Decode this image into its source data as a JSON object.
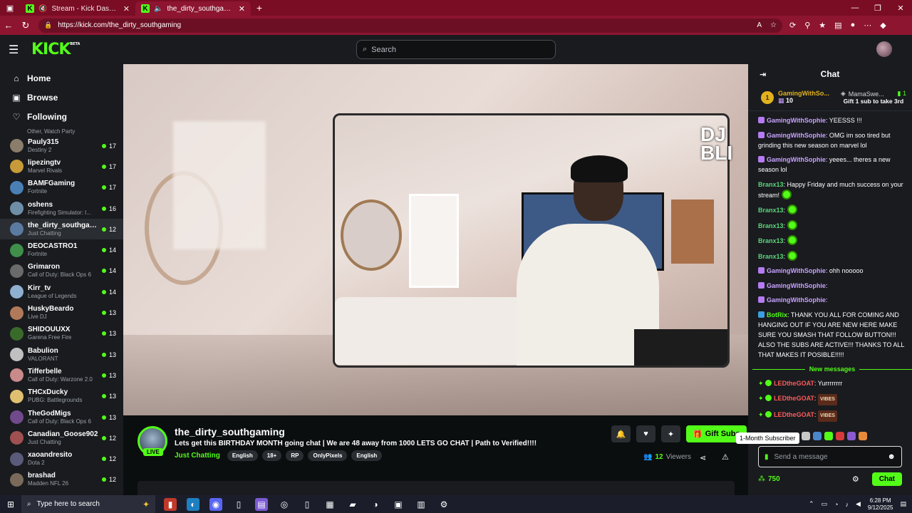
{
  "browser": {
    "tabs": [
      {
        "title": "Stream - Kick Dashboard",
        "active": false
      },
      {
        "title": "the_dirty_southgaming Stream",
        "active": true
      }
    ],
    "url": "https://kick.com/the_dirty_southgaming"
  },
  "header": {
    "logo": "KICK",
    "logo_tag": "BETA",
    "search_placeholder": "Search"
  },
  "sidebar": {
    "nav": [
      {
        "label": "Home",
        "icon": "home-icon"
      },
      {
        "label": "Browse",
        "icon": "browse-icon"
      },
      {
        "label": "Following",
        "icon": "heart-icon"
      }
    ],
    "cut_category": "Other, Watch Party",
    "channels": [
      {
        "name": "Pauly315",
        "category": "Destiny 2",
        "viewers": "17",
        "color": "#8a7d6a"
      },
      {
        "name": "lipezingtv",
        "category": "Marvel Rivals",
        "viewers": "17",
        "color": "#c79a3a"
      },
      {
        "name": "BAMFGaming",
        "category": "Fortnite",
        "viewers": "17",
        "color": "#4a7fb5"
      },
      {
        "name": "oshens",
        "category": "Firefighting Simulator: I...",
        "viewers": "16",
        "color": "#6f8fa8"
      },
      {
        "name": "the_dirty_southgami...",
        "category": "Just Chatting",
        "viewers": "12",
        "color": "#5a7aa0",
        "active": true
      },
      {
        "name": "DEOCASTRO1",
        "category": "Fortnite",
        "viewers": "14",
        "color": "#3f8f4a"
      },
      {
        "name": "Grimaron",
        "category": "Call of Duty: Black Ops 6",
        "viewers": "14",
        "color": "#6a6a6a"
      },
      {
        "name": "Kirr_tv",
        "category": "League of Legends",
        "viewers": "14",
        "color": "#8fb0d0"
      },
      {
        "name": "HuskyBeardo",
        "category": "Live DJ",
        "viewers": "13",
        "color": "#b07a5a"
      },
      {
        "name": "SHIDOUUXX",
        "category": "Garena Free Fire",
        "viewers": "13",
        "color": "#3a6a2a"
      },
      {
        "name": "Babulion",
        "category": "VALORANT",
        "viewers": "13",
        "color": "#c0c0c0"
      },
      {
        "name": "Tifferbelle",
        "category": "Call of Duty: Warzone 2.0",
        "viewers": "13",
        "color": "#c98a8a"
      },
      {
        "name": "THCxDucky",
        "category": "PUBG: Battlegrounds",
        "viewers": "13",
        "color": "#e0c070"
      },
      {
        "name": "TheGodMigs",
        "category": "Call of Duty: Black Ops 6",
        "viewers": "13",
        "color": "#704a8a"
      },
      {
        "name": "Canadian_Goose902",
        "category": "Just Chatting",
        "viewers": "12",
        "color": "#a05050"
      },
      {
        "name": "xaoandresito",
        "category": "Dota 2",
        "viewers": "12",
        "color": "#5a5a7a"
      },
      {
        "name": "brashad",
        "category": "Madden NFL 26",
        "viewers": "12",
        "color": "#7a6a5a"
      }
    ]
  },
  "video": {
    "overlay_lines": [
      "DJ",
      "BLI"
    ]
  },
  "stream": {
    "channel_name": "the_dirty_southgaming",
    "live_label": "LIVE",
    "title": "Lets get this BIRTHDAY MONTH going chat | We are 48 away from 1000 LETS GO CHAT | Path to Verified!!!!",
    "category": "Just Chatting",
    "tags": [
      "English",
      "18+",
      "RP",
      "OnlyPixels",
      "English"
    ],
    "gift_label": "Gift Subs",
    "viewer_count": "12",
    "viewers_label": "Viewers"
  },
  "chat": {
    "title": "Chat",
    "pinned": {
      "left_name": "GamingWithSo...",
      "left_rank": "1",
      "left_count": "10",
      "right_name": "MamaSwe...",
      "right_count": "1",
      "right_text": "Gift 1 sub to take 3rd"
    },
    "messages": [
      {
        "user": "GamingWithSophie",
        "color": "#c9a2ff",
        "badge": "#b57cf2",
        "text": ": YEESSS !!!"
      },
      {
        "user": "GamingWithSophie",
        "color": "#c9a2ff",
        "badge": "#b57cf2",
        "text": ": OMG im soo tired but grinding this new season on marvel lol"
      },
      {
        "user": "GamingWithSophie",
        "color": "#c9a2ff",
        "badge": "#b57cf2",
        "text": ": yeees... theres a new season lol"
      },
      {
        "user": "Branx13",
        "color": "#5bd67a",
        "badge": "",
        "text": ": Happy Friday and much success on your stream!",
        "emote": true
      },
      {
        "user": "Branx13",
        "color": "#5bd67a",
        "badge": "",
        "text": ":",
        "emote": true
      },
      {
        "user": "Branx13",
        "color": "#5bd67a",
        "badge": "",
        "text": ":",
        "emote": true
      },
      {
        "user": "Branx13",
        "color": "#5bd67a",
        "badge": "",
        "text": ":",
        "emote": true
      },
      {
        "user": "Branx13",
        "color": "#5bd67a",
        "badge": "",
        "text": ":",
        "emote": true
      },
      {
        "user": "GamingWithSophie",
        "color": "#c9a2ff",
        "badge": "#b57cf2",
        "text": ": ohh nooooo"
      },
      {
        "user": "GamingWithSophie",
        "color": "#c9a2ff",
        "badge": "#b57cf2",
        "text": ":"
      },
      {
        "user": "GamingWithSophie",
        "color": "#c9a2ff",
        "badge": "#b57cf2",
        "text": ":"
      },
      {
        "user": "BotRix",
        "color": "#53fc18",
        "badge": "#3aa0e0",
        "text": ": THANK YOU ALL FOR COMING AND HANGING OUT IF YOU ARE NEW HERE MAKE SURE YOU SMASH THAT FOLLOW BUTTON!!! ALSO THE SUBS ARE ACTIVE!!! THANKS TO ALL THAT MAKES IT POSIBLE!!!!!"
      }
    ],
    "new_messages_label": "New messages",
    "new_messages": [
      {
        "user": "LEDtheGOAT",
        "color": "#ff5a5a",
        "text": ": Yurrrrrrrr",
        "vibes": false
      },
      {
        "user": "LEDtheGOAT",
        "color": "#ff5a5a",
        "text": ":",
        "vibes": true
      },
      {
        "user": "LEDtheGOAT",
        "color": "#ff5a5a",
        "text": ":",
        "vibes": true
      }
    ],
    "vibes_label": "VIBES",
    "tooltip": "1-Month Subscriber",
    "input_placeholder": "Send a message",
    "points": "750",
    "send_label": "Chat"
  },
  "taskbar": {
    "search_placeholder": "Type here to search",
    "time": "6:28 PM",
    "date": "9/12/2025"
  }
}
